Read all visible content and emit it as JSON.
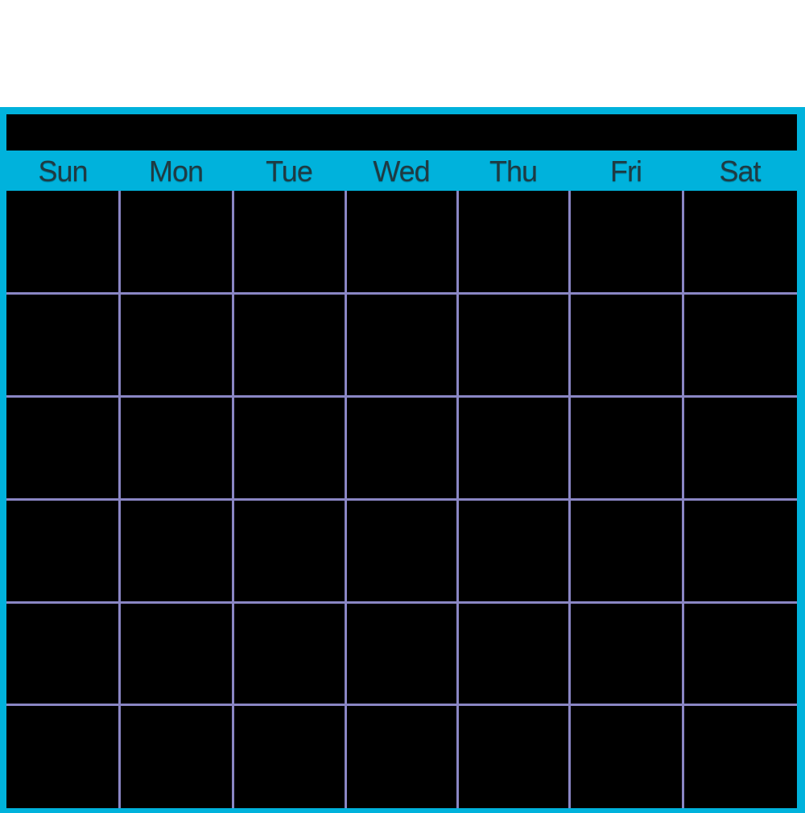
{
  "calendar": {
    "month_title": "",
    "weekdays": [
      "Sun",
      "Mon",
      "Tue",
      "Wed",
      "Thu",
      "Fri",
      "Sat"
    ],
    "rows": 6,
    "columns": 7,
    "colors": {
      "frame": "#00b2dc",
      "cell_background": "#000000",
      "grid_lines": "#8a86c4",
      "weekday_text": "#1f3a42"
    }
  }
}
